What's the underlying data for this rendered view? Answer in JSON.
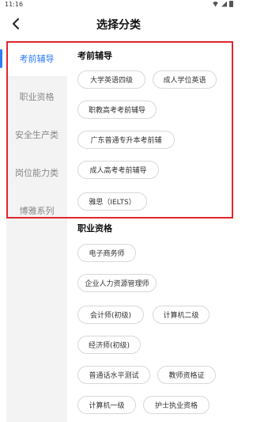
{
  "status_bar": {
    "time": "11:16"
  },
  "header": {
    "back_symbol": "‹",
    "title": "选择分类"
  },
  "sidebar": {
    "items": [
      {
        "label": "考前辅导",
        "active": true
      },
      {
        "label": "职业资格",
        "active": false
      },
      {
        "label": "安全生产类",
        "active": false
      },
      {
        "label": "岗位能力类",
        "active": false
      },
      {
        "label": "博雅系列",
        "active": false
      }
    ]
  },
  "sections": [
    {
      "title": "考前辅导",
      "chips": [
        "大学英语四级",
        "成人学位英语",
        "职教高考考前辅导",
        "广东普通专升本考前辅",
        "成人高考考前辅导",
        "雅思（IELTS）"
      ]
    },
    {
      "title": "职业资格",
      "chips": [
        "电子商务师",
        "企业人力资源管理师",
        "会计师(初级)",
        "计算机二级",
        "经济师(初级)",
        "普通话水平测试",
        "教师资格证",
        "计算机一级",
        "护士执业资格"
      ]
    }
  ],
  "colors": {
    "accent": "#2f7cf6",
    "highlight": "#e0262b",
    "sidebar_bg": "#f3f3f3"
  }
}
